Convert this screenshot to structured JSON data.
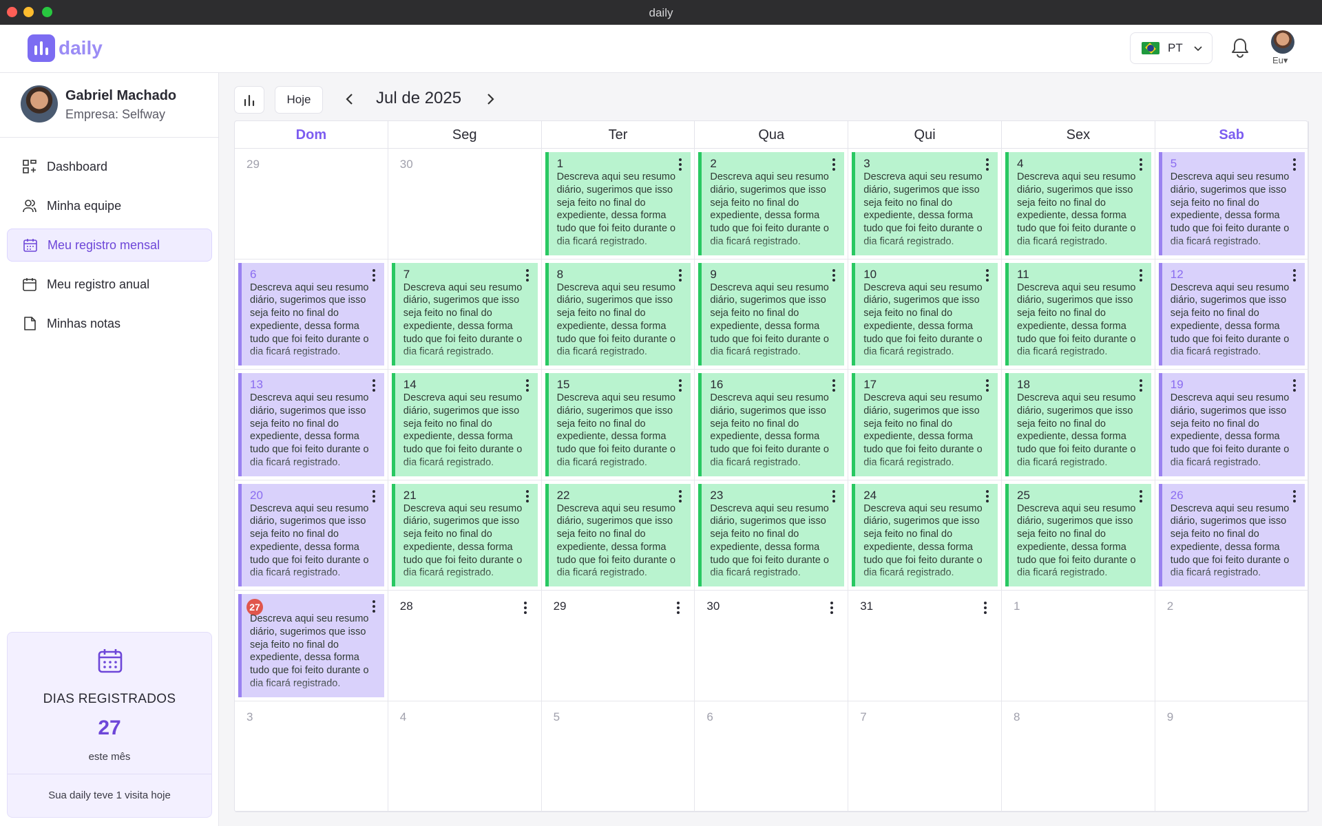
{
  "window": {
    "title": "daily"
  },
  "header": {
    "logo_text": "daily",
    "language": "PT",
    "user_label": "Eu▾"
  },
  "sidebar": {
    "profile": {
      "name": "Gabriel Machado",
      "company": "Empresa: Selfway"
    },
    "items": [
      {
        "label": "Dashboard",
        "icon": "dashboard-icon"
      },
      {
        "label": "Minha equipe",
        "icon": "team-icon"
      },
      {
        "label": "Meu registro mensal",
        "icon": "calendar-icon",
        "active": true
      },
      {
        "label": "Meu registro anual",
        "icon": "calendar-icon"
      },
      {
        "label": "Minhas notas",
        "icon": "note-icon"
      }
    ],
    "stats": {
      "title": "DIAS REGISTRADOS",
      "count": "27",
      "period": "este mês",
      "visits": "Sua daily teve 1 visita hoje"
    }
  },
  "toolbar": {
    "today_label": "Hoje",
    "month_label": "Jul de 2025"
  },
  "calendar": {
    "weekdays": [
      "Dom",
      "Seg",
      "Ter",
      "Qua",
      "Qui",
      "Sex",
      "Sab"
    ],
    "entry_text": "Descreva aqui seu resumo diário, sugerimos que isso seja feito no final do expediente, dessa forma tudo que foi feito durante o dia ficará registrado.",
    "today": "27",
    "days": [
      {
        "n": "29",
        "kind": "outside"
      },
      {
        "n": "30",
        "kind": "outside"
      },
      {
        "n": "1",
        "kind": "green"
      },
      {
        "n": "2",
        "kind": "green"
      },
      {
        "n": "3",
        "kind": "green"
      },
      {
        "n": "4",
        "kind": "green"
      },
      {
        "n": "5",
        "kind": "purple"
      },
      {
        "n": "6",
        "kind": "purple"
      },
      {
        "n": "7",
        "kind": "green"
      },
      {
        "n": "8",
        "kind": "green"
      },
      {
        "n": "9",
        "kind": "green"
      },
      {
        "n": "10",
        "kind": "green"
      },
      {
        "n": "11",
        "kind": "green"
      },
      {
        "n": "12",
        "kind": "purple"
      },
      {
        "n": "13",
        "kind": "purple"
      },
      {
        "n": "14",
        "kind": "green"
      },
      {
        "n": "15",
        "kind": "green"
      },
      {
        "n": "16",
        "kind": "green"
      },
      {
        "n": "17",
        "kind": "green"
      },
      {
        "n": "18",
        "kind": "green"
      },
      {
        "n": "19",
        "kind": "purple"
      },
      {
        "n": "20",
        "kind": "purple"
      },
      {
        "n": "21",
        "kind": "green"
      },
      {
        "n": "22",
        "kind": "green"
      },
      {
        "n": "23",
        "kind": "green"
      },
      {
        "n": "24",
        "kind": "green"
      },
      {
        "n": "25",
        "kind": "green"
      },
      {
        "n": "26",
        "kind": "purple"
      },
      {
        "n": "27",
        "kind": "purple"
      },
      {
        "n": "28",
        "kind": "empty"
      },
      {
        "n": "29",
        "kind": "empty"
      },
      {
        "n": "30",
        "kind": "empty"
      },
      {
        "n": "31",
        "kind": "empty"
      },
      {
        "n": "1",
        "kind": "outside"
      },
      {
        "n": "2",
        "kind": "outside"
      },
      {
        "n": "3",
        "kind": "outside"
      },
      {
        "n": "4",
        "kind": "outside"
      },
      {
        "n": "5",
        "kind": "outside"
      },
      {
        "n": "6",
        "kind": "outside"
      },
      {
        "n": "7",
        "kind": "outside"
      },
      {
        "n": "8",
        "kind": "outside"
      },
      {
        "n": "9",
        "kind": "outside"
      }
    ]
  },
  "colors": {
    "accent": "#6d46d8",
    "weekday_entry": "#b9f3cf",
    "weekend_entry": "#d9d1fb",
    "today": "#e0564c"
  }
}
